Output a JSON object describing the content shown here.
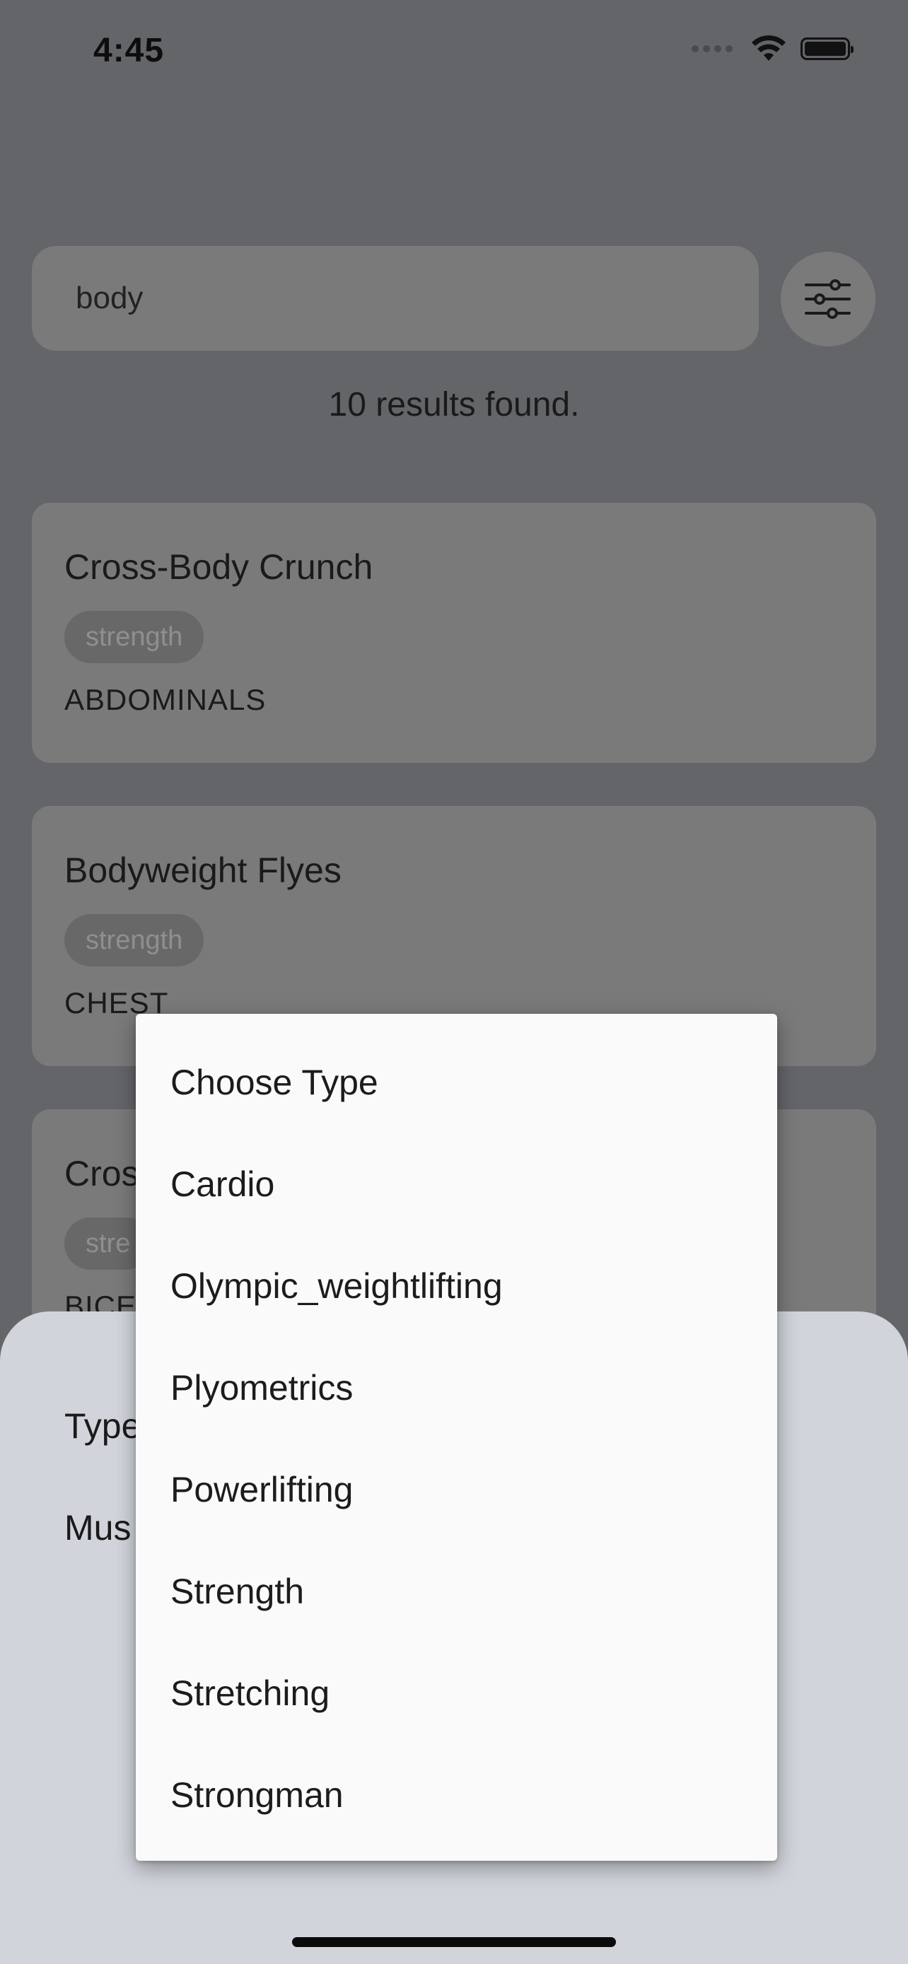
{
  "status_bar": {
    "time": "4:45"
  },
  "search": {
    "query": "body",
    "results_text": "10 results found."
  },
  "exercises": [
    {
      "name": "Cross-Body Crunch",
      "type": "strength",
      "muscle": "ABDOMINALS"
    },
    {
      "name": "Bodyweight Flyes",
      "type": "strength",
      "muscle": "CHEST"
    },
    {
      "name": "Cros",
      "type": "stre",
      "muscle": "BICE"
    }
  ],
  "filter_sheet": {
    "type_label": "Type",
    "muscle_label": "Mus"
  },
  "dropdown": {
    "items": [
      "Choose Type",
      "Cardio",
      "Olympic_weightlifting",
      "Plyometrics",
      "Powerlifting",
      "Strength",
      "Stretching",
      "Strongman"
    ]
  },
  "colors": {
    "overlay_background": "#636569",
    "card": "#7a7a7a",
    "sheet": "#d1d4db",
    "menu": "#fafafa"
  },
  "icons": [
    "wifi-icon",
    "battery-icon",
    "signal-icon",
    "sliders-icon"
  ]
}
